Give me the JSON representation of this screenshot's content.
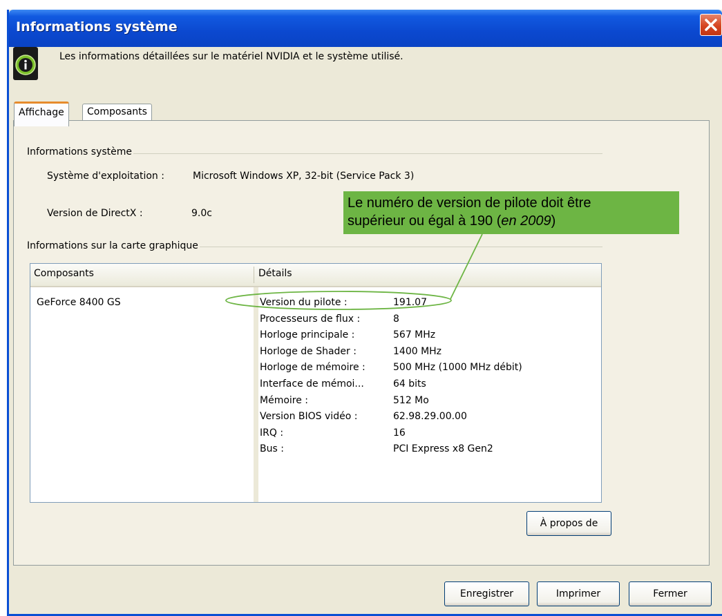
{
  "window": {
    "title": "Informations système",
    "close_icon": "close-icon"
  },
  "header": {
    "icon": "nvidia-info-icon",
    "text": "Les informations détaillées sur le matériel NVIDIA et le système utilisé."
  },
  "tabs": [
    {
      "label": "Affichage",
      "active": true
    },
    {
      "label": "Composants",
      "active": false
    }
  ],
  "system_info": {
    "group_title": "Informations système",
    "os_label": "Système d'exploitation :",
    "os_value": "Microsoft Windows XP, 32-bit (Service Pack 3)",
    "directx_label": "Version de DirectX :",
    "directx_value": "9.0c"
  },
  "graphics_info": {
    "group_title": "Informations sur la carte graphique",
    "columns": [
      "Composants",
      "Détails"
    ],
    "component": "GeForce 8400 GS",
    "details": [
      {
        "label": "Version du pilote :",
        "value": "191.07"
      },
      {
        "label": "Processeurs de flux :",
        "value": "8"
      },
      {
        "label": "Horloge principale :",
        "value": "567 MHz"
      },
      {
        "label": "Horloge de Shader :",
        "value": "1400 MHz"
      },
      {
        "label": "Horloge de mémoire :",
        "value": "500 MHz (1000 MHz débit)"
      },
      {
        "label": "Interface de mémoi...",
        "value": "64 bits"
      },
      {
        "label": "Mémoire :",
        "value": "512 Mo"
      },
      {
        "label": "Version BIOS vidéo :",
        "value": "62.98.29.00.00"
      },
      {
        "label": "IRQ :",
        "value": "16"
      },
      {
        "label": "Bus :",
        "value": "PCI Express x8 Gen2"
      }
    ]
  },
  "buttons": {
    "about": "À propos de",
    "save": "Enregistrer",
    "print": "Imprimer",
    "close": "Fermer"
  },
  "annotation": {
    "line1": "Le numéro de version de pilote doit être",
    "line2_prefix": "supérieur ou égal à 190 (",
    "line2_italic": "en 2009",
    "line2_suffix": ")",
    "color": "#6db544"
  },
  "colors": {
    "titlebar": "#0a48cf",
    "window_bg": "#ece9d8",
    "tab_accent": "#e68b2c",
    "close": "#d64521"
  }
}
